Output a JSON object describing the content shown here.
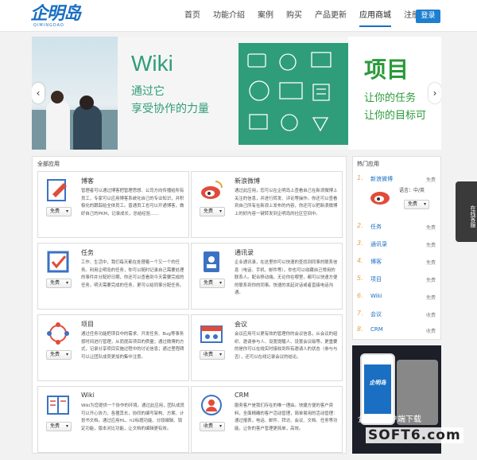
{
  "header": {
    "logo": "企明岛",
    "logo_sub": "QIMINGDAO",
    "nav": [
      "首页",
      "功能介绍",
      "案例",
      "购买",
      "产品更新",
      "应用商城",
      "注册"
    ],
    "active_nav": "应用商城",
    "login": "登录"
  },
  "banner": {
    "slide_title": "Wiki",
    "slide_line1": "通过它",
    "slide_line2": "享受协作的力量",
    "next_title": "项目",
    "next_line1": "让你的任务",
    "next_line2": "让你的目标可",
    "prev_arrow": "‹",
    "next_arrow": "›"
  },
  "main": {
    "title": "全部应用",
    "cards": [
      {
        "name": "博客",
        "desc": "管理者可以通过博客把管理思想、公司方向传播给所有员工，专家可以应用博客系统化自己的专业知识，并积极化的跟踪给全体员工。普通员工也可以开通博客，做好自己的PKM，记录成长，总结经验……",
        "price": "免费",
        "icon": "blog-icon",
        "color": "#e14c3a"
      },
      {
        "name": "新浪微博",
        "desc": "通过此应用，您可以在企明岛上查看自己在新浪微博上关注的信息，并进行转发、评论等操作。你还可以查看到自己所有在新浪上发布的内容，你还可以把新浪微博上的好内容一键转发到企明岛的社区空间中。",
        "price": "免费",
        "icon": "weibo-icon",
        "color": "#e14c3a"
      },
      {
        "name": "任务",
        "desc": "工作、生活中，我们每天都在处理着一个又一个的任务。利用企明岛的任务，你可以随时记录自己需要处理的事件并分配好日期，你还可以查看到今天需要完成的任务，明天需要完成的任务，更可以给同事分配任务。",
        "price": "免费",
        "icon": "task-icon",
        "color": "#3b72c4"
      },
      {
        "name": "通讯录",
        "desc": "企业通讯录，在这里你可以快速的查找到同事的联系信息（电话、手机、邮件等）。你也可以收藏自己常用的联系人。配合移动端，无论你在哪里，都可以快速方便的联系到你的同事。快速的发起对话或者直接电话沟通。",
        "price": "免费",
        "icon": "contacts-icon",
        "color": "#3b72c4"
      },
      {
        "name": "项目",
        "desc": "通过任务功能把项目中的需求、开发任务、Bug等事务按时间进行管理，从而提高项目的质量；通过微博的方式，记录分享项目实施过程中的讨论信息；通过里程碑可以让团队成员更加的集中注意。",
        "price": "免费",
        "icon": "project-icon",
        "color": "#e14c3a"
      },
      {
        "name": "会议",
        "desc": "会议应用可以更有效的管理你的会议信息，从会议的组织、邀请参与人、设置提醒人、设置会议级等。更重要的是你可以在线实时接收到所有邀请人的状态（参与与否），还可以在线记录会议的结论。",
        "price": "收费",
        "icon": "meeting-icon",
        "color": "#3b72c4"
      },
      {
        "name": "Wiki",
        "desc": "Wiki为您提供一个协作的环境。通过此应用，团队成员可以开心协力，各擅其长，协同的编写架构、方案、计划书文档。通过应用HL、h2标题功能、分段编辑、锁定功能，版本对比功能，让文档的编辑更有效。",
        "price": "免费",
        "icon": "wiki-icon",
        "color": "#3b72c4"
      },
      {
        "name": "CRM",
        "desc": "服务客户是我们存在的唯一理由。快捷方便的客户资料，全面精确的客户活动管理，简单易用的活动管理：通过报表，电话、邮件、拜访、会议、文档、任务等功能，让你的客户管理更简单，高效。",
        "price": "收费",
        "icon": "crm-icon",
        "color": "#3b72c4"
      }
    ]
  },
  "side": {
    "title": "热门应用",
    "featured": {
      "rank": "1.",
      "name": "新浪微博",
      "price": "免费",
      "lang": "语言：中/英",
      "select": "免费"
    },
    "items": [
      {
        "rank": "2.",
        "name": "任务",
        "price": "免费"
      },
      {
        "rank": "3.",
        "name": "通讯录",
        "price": "免费"
      },
      {
        "rank": "4.",
        "name": "博客",
        "price": "免费"
      },
      {
        "rank": "5.",
        "name": "项目",
        "price": "免费"
      },
      {
        "rank": "6.",
        "name": "Wiki",
        "price": "免费"
      },
      {
        "rank": "7.",
        "name": "会议",
        "price": "收费"
      },
      {
        "rank": "8.",
        "name": "CRM",
        "price": "收费"
      }
    ]
  },
  "promo": {
    "phone_logo": "企明岛",
    "text": "企明岛客户端下载"
  },
  "service": "在线客服",
  "watermark": "SOFT6.com"
}
